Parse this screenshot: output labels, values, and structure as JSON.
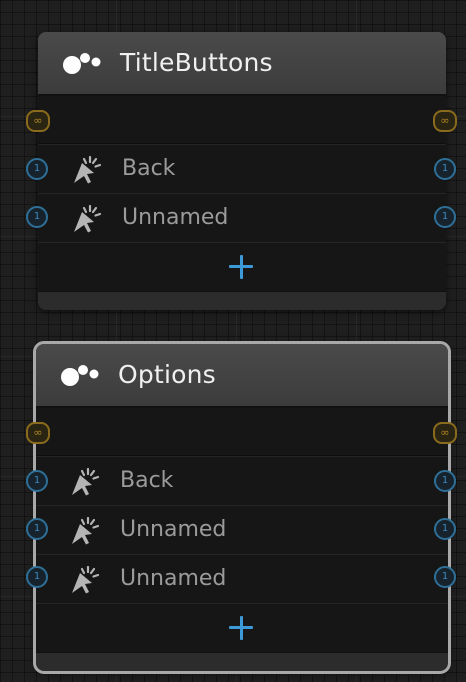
{
  "nodes": [
    {
      "title": "TitleButtons",
      "flow_port": "∞",
      "outputs": [
        {
          "label": "Back",
          "port": "1"
        },
        {
          "label": "Unnamed",
          "port": "1"
        }
      ]
    },
    {
      "title": "Options",
      "flow_port": "∞",
      "outputs": [
        {
          "label": "Back",
          "port": "1"
        },
        {
          "label": "Unnamed",
          "port": "1"
        },
        {
          "label": "Unnamed",
          "port": "1"
        }
      ]
    }
  ],
  "colors": {
    "background": "#1f1f1f",
    "header": "#424242",
    "flow_port": "#b08926",
    "data_port": "#3a87b9",
    "add_button": "#3d9ad9",
    "selection_outline": "#a8a8a8"
  },
  "icons": {
    "node_header": "node-cluster-icon",
    "output": "cursor-click-icon",
    "add": "plus-icon"
  }
}
